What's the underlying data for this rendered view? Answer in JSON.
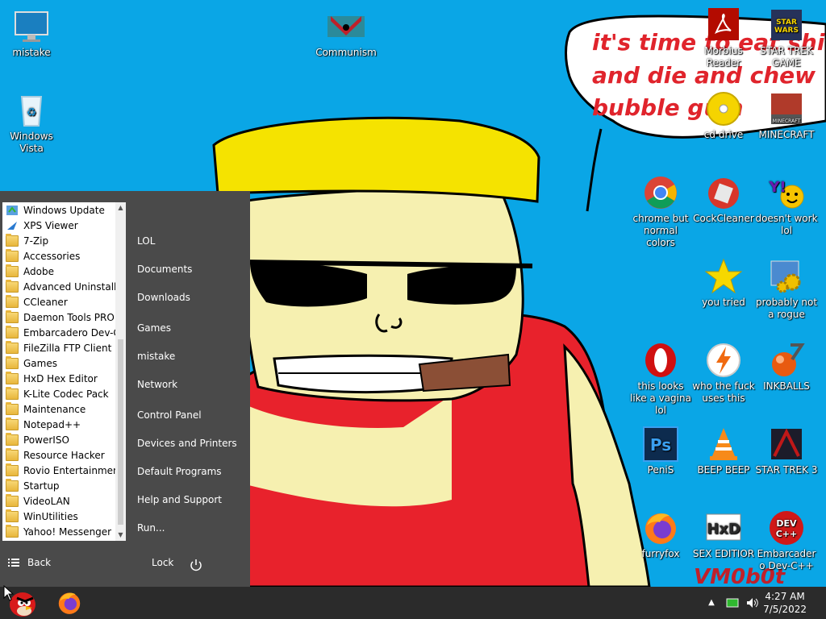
{
  "desktop": {
    "speech_text_lines": [
      "it's time to eat shit",
      "and die and chew",
      "bubble gum"
    ],
    "watermark": "VM0b0t",
    "icons": [
      {
        "label": "mistake",
        "icon": "monitor-icon"
      },
      {
        "label": "Communism",
        "icon": "communism-flag-icon"
      },
      {
        "label": "Windows Vista",
        "icon": "recycle-bin-icon"
      },
      {
        "label": "Morbius Reader",
        "icon": "acrobat-reader-icon"
      },
      {
        "label": "STAR TREK GAME",
        "icon": "star-wars-game-icon"
      },
      {
        "label": "cd drive",
        "icon": "cd-drive-icon"
      },
      {
        "label": "MINECRAFT",
        "icon": "minecraft-icon"
      },
      {
        "label": "chrome but normal colors",
        "icon": "chrome-icon"
      },
      {
        "label": "CockCleaner",
        "icon": "ccleaner-icon"
      },
      {
        "label": "doesn't work lol",
        "icon": "yahoo-messenger-icon"
      },
      {
        "label": "you tried",
        "icon": "star-icon"
      },
      {
        "label": "probably not a rogue",
        "icon": "gears-window-icon"
      },
      {
        "label": "this looks like a vagina lol",
        "icon": "opera-icon"
      },
      {
        "label": "who the fuck uses this",
        "icon": "avast-icon"
      },
      {
        "label": "INKBALLS",
        "icon": "inkball-icon"
      },
      {
        "label": "PeniS",
        "icon": "photoshop-icon"
      },
      {
        "label": "BEEP BEEP",
        "icon": "vlc-icon"
      },
      {
        "label": "STAR TREK 3",
        "icon": "star-trek-3-icon"
      },
      {
        "label": "furryfox",
        "icon": "firefox-icon"
      },
      {
        "label": "SEX EDITIOR",
        "icon": "hxd-editor-icon"
      },
      {
        "label": "Embarcadero Dev-C++",
        "icon": "dev-cpp-icon"
      }
    ]
  },
  "start_menu": {
    "programs": [
      {
        "label": "Windows Update",
        "icon": "windows-update-icon"
      },
      {
        "label": "XPS Viewer",
        "icon": "xps-viewer-icon"
      },
      {
        "label": "7-Zip",
        "icon": "folder-icon"
      },
      {
        "label": "Accessories",
        "icon": "folder-icon"
      },
      {
        "label": "Adobe",
        "icon": "folder-icon"
      },
      {
        "label": "Advanced Uninstaller",
        "icon": "folder-icon"
      },
      {
        "label": "CCleaner",
        "icon": "folder-icon"
      },
      {
        "label": "Daemon Tools PRO",
        "icon": "folder-icon"
      },
      {
        "label": "Embarcadero Dev-C+",
        "icon": "folder-icon"
      },
      {
        "label": "FileZilla FTP Client",
        "icon": "folder-icon"
      },
      {
        "label": "Games",
        "icon": "folder-icon"
      },
      {
        "label": "HxD Hex Editor",
        "icon": "folder-icon"
      },
      {
        "label": "K-Lite Codec Pack",
        "icon": "folder-icon"
      },
      {
        "label": "Maintenance",
        "icon": "folder-icon"
      },
      {
        "label": "Notepad++",
        "icon": "folder-icon"
      },
      {
        "label": "PowerISO",
        "icon": "folder-icon"
      },
      {
        "label": "Resource Hacker",
        "icon": "folder-icon"
      },
      {
        "label": "Rovio Entertainment",
        "icon": "folder-icon"
      },
      {
        "label": "Startup",
        "icon": "folder-icon"
      },
      {
        "label": "VideoLAN",
        "icon": "folder-icon"
      },
      {
        "label": "WinUtilities",
        "icon": "folder-icon"
      },
      {
        "label": "Yahoo! Messenger",
        "icon": "folder-icon"
      }
    ],
    "links": [
      "LOL",
      "Documents",
      "Downloads",
      "Games",
      "mistake",
      "Network",
      "Control Panel",
      "Devices and Printers",
      "Default Programs",
      "Help and Support",
      "Run..."
    ],
    "back_label": "Back",
    "lock_label": "Lock"
  },
  "taskbar": {
    "pinned": [
      {
        "name": "angry-birds-icon"
      },
      {
        "name": "firefox-icon"
      }
    ],
    "clock_time": "4:27 AM",
    "clock_date": "7/5/2022"
  },
  "colors": {
    "desktop_bg": "#0aa6e6",
    "start_menu_bg": "#4a4a4a",
    "taskbar_bg": "#2b2b2b",
    "speech_text": "#e0242c"
  }
}
